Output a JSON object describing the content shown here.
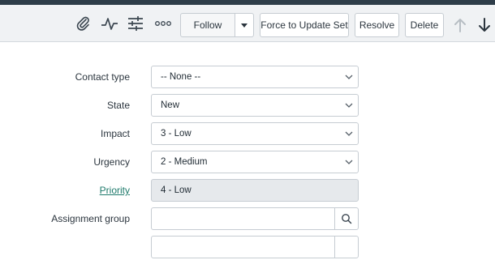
{
  "toolbar": {
    "icons": [
      "paperclip-icon",
      "activity-icon",
      "sliders-icon",
      "more-options-icon"
    ],
    "follow_label": "Follow",
    "force_label": "Force to Update Set",
    "resolve_label": "Resolve",
    "delete_label": "Delete"
  },
  "form": {
    "contact_type": {
      "label": "Contact type",
      "value": "-- None --"
    },
    "state": {
      "label": "State",
      "value": "New"
    },
    "impact": {
      "label": "Impact",
      "value": "3 - Low"
    },
    "urgency": {
      "label": "Urgency",
      "value": "2 - Medium"
    },
    "priority": {
      "label": "Priority",
      "value": "4 - Low"
    },
    "assignment_group": {
      "label": "Assignment group",
      "value": ""
    }
  },
  "colors": {
    "link": "#1e7a6b",
    "topbar": "#2e3d49",
    "toolbar": "#f0f2f4"
  }
}
